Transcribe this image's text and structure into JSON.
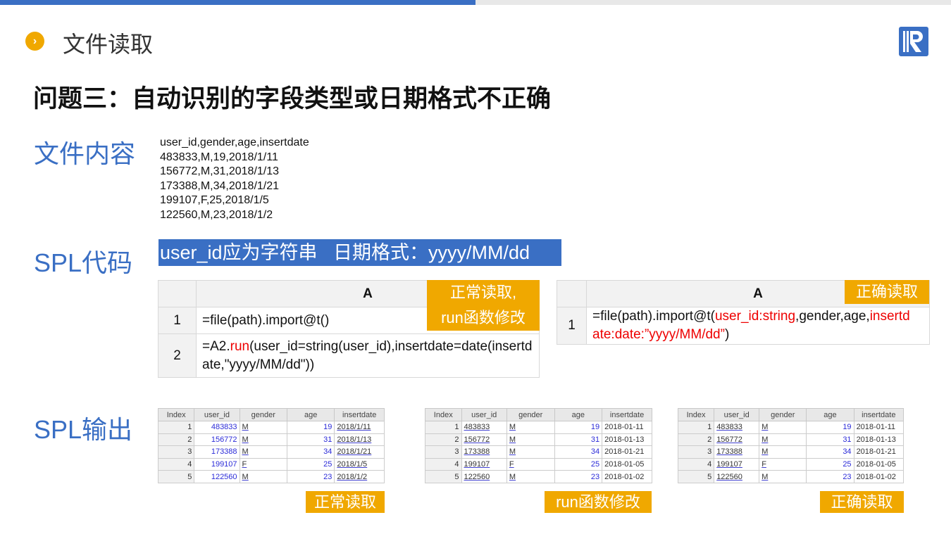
{
  "header": {
    "section_title": "文件读取",
    "bullet_icon": "chevron-right-icon",
    "logo": "R"
  },
  "heading": "问题三：自动识别的字段类型或日期格式不正确",
  "labels": {
    "file": "文件内容",
    "code": "SPL代码",
    "output": "SPL输出"
  },
  "file_content": "user_id,gender,age,insertdate\n483833,M,19,2018/1/11\n156772,M,31,2018/1/13\n173388,M,34,2018/1/21\n199107,F,25,2018/1/5\n122560,M,23,2018/1/2",
  "banner": "user_id应为字符串   日期格式：yyyy/MM/dd",
  "code1": {
    "col": "A",
    "tag": "正常读取,\nrun函数修改",
    "rows": [
      {
        "n": "1",
        "parts": [
          {
            "t": "=file(path).import@t()"
          }
        ]
      },
      {
        "n": "2",
        "parts": [
          {
            "t": "=A2."
          },
          {
            "t": "run",
            "red": true
          },
          {
            "t": "(user_id=string(user_id),insertdate=date(insertdate,\"yyyy/MM/dd\"))"
          }
        ]
      }
    ]
  },
  "code2": {
    "col": "A",
    "tag": "正确读取",
    "rows": [
      {
        "n": "1",
        "parts": [
          {
            "t": "=file(path).import@t("
          },
          {
            "t": "user_id:string",
            "red": true
          },
          {
            "t": ",gender,age,"
          },
          {
            "t": "insertdate:date:”yyyy/MM/dd”",
            "red": true
          },
          {
            "t": ")"
          }
        ]
      }
    ]
  },
  "outputs": [
    {
      "tag": "正常读取",
      "mode": "raw",
      "columns": [
        "Index",
        "user_id",
        "gender",
        "age",
        "insertdate"
      ],
      "rows": [
        [
          "1",
          "483833",
          "M",
          "19",
          "2018/1/11"
        ],
        [
          "2",
          "156772",
          "M",
          "31",
          "2018/1/13"
        ],
        [
          "3",
          "173388",
          "M",
          "34",
          "2018/1/21"
        ],
        [
          "4",
          "199107",
          "F",
          "25",
          "2018/1/5"
        ],
        [
          "5",
          "122560",
          "M",
          "23",
          "2018/1/2"
        ]
      ]
    },
    {
      "tag": "run函数修改",
      "mode": "fixed",
      "columns": [
        "Index",
        "user_id",
        "gender",
        "age",
        "insertdate"
      ],
      "rows": [
        [
          "1",
          "483833",
          "M",
          "19",
          "2018-01-11"
        ],
        [
          "2",
          "156772",
          "M",
          "31",
          "2018-01-13"
        ],
        [
          "3",
          "173388",
          "M",
          "34",
          "2018-01-21"
        ],
        [
          "4",
          "199107",
          "F",
          "25",
          "2018-01-05"
        ],
        [
          "5",
          "122560",
          "M",
          "23",
          "2018-01-02"
        ]
      ]
    },
    {
      "tag": "正确读取",
      "mode": "fixed",
      "columns": [
        "Index",
        "user_id",
        "gender",
        "age",
        "insertdate"
      ],
      "rows": [
        [
          "1",
          "483833",
          "M",
          "19",
          "2018-01-11"
        ],
        [
          "2",
          "156772",
          "M",
          "31",
          "2018-01-13"
        ],
        [
          "3",
          "173388",
          "M",
          "34",
          "2018-01-21"
        ],
        [
          "4",
          "199107",
          "F",
          "25",
          "2018-01-05"
        ],
        [
          "5",
          "122560",
          "M",
          "23",
          "2018-01-02"
        ]
      ]
    }
  ]
}
